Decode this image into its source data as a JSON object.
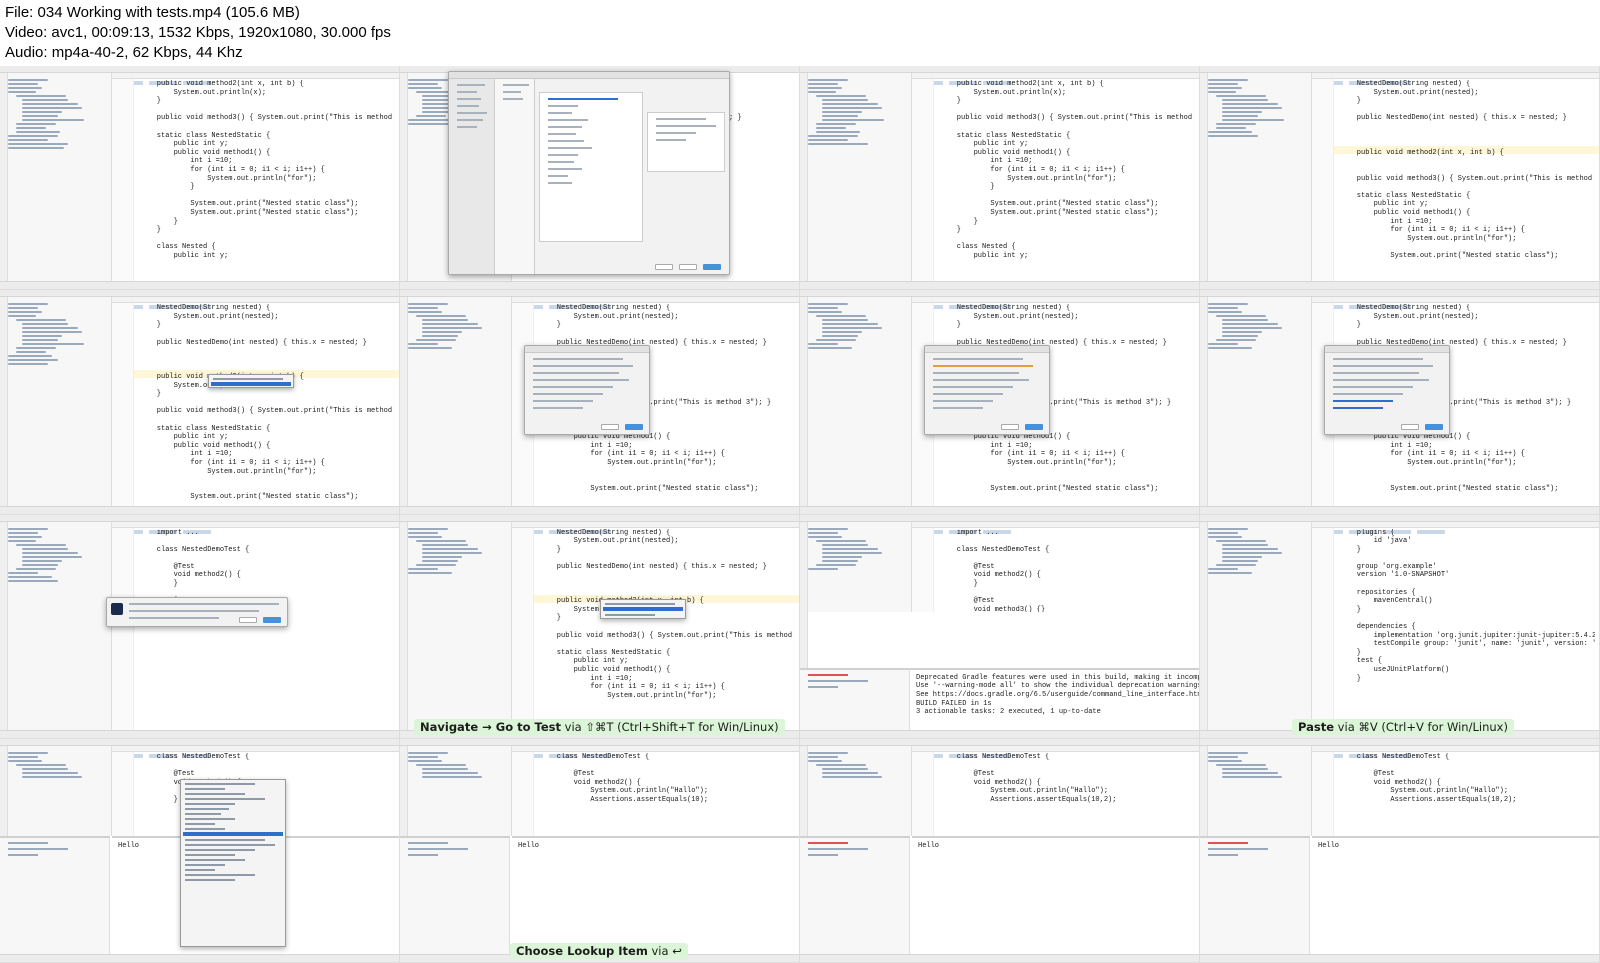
{
  "header": {
    "file_line": "File: 034 Working with tests.mp4 (105.6 MB)",
    "video_line": "Video: avc1, 00:09:13, 1532 Kbps, 1920x1080, 30.000 fps",
    "audio_line": "Audio: mp4a-40-2, 62 Kbps, 44 Khz"
  },
  "frames": [
    {
      "code": "    public void method2(int x, int b) {\n        System.out.println(x);\n    }\n\n    public void method3() { System.out.print(\"This is method 3\"); }\n\n    static class NestedStatic {\n        public int y;\n        public void method1() {\n            int i =10;\n            for (int i1 = 0; i1 < i; i1++) {\n                System.out.println(\"for\");\n            }\n\n            System.out.print(\"Nested static class\");\n            System.out.print(\"Nested static class\");\n        }\n    }\n\n    class Nested {\n        public int y;"
    },
    {
      "code": "\n\n\n\n                                   method 3\"); }"
    },
    {
      "code": "    public void method2(int x, int b) {\n        System.out.println(x);\n    }\n\n    public void method3() { System.out.print(\"This is method 3\"); }\n\n    static class NestedStatic {\n        public int y;\n        public void method1() {\n            int i =10;\n            for (int i1 = 0; i1 < i; i1++) {\n                System.out.println(\"for\");\n            }\n\n            System.out.print(\"Nested static class\");\n            System.out.print(\"Nested static class\");\n        }\n    }\n\n    class Nested {\n        public int y;"
    },
    {
      "code": "    NestedDemo(String nested) {\n        System.out.print(nested);\n    }\n\n    public NestedDemo(int nested) { this.x = nested; }\n\n\n\n    public void method2(int x, int b) {\n\n\n    public void method3() { System.out.print(\"This is method 3\"); }\n\n    static class NestedStatic {\n        public int y;\n        public void method1() {\n            int i =10;\n            for (int i1 = 0; i1 < i; i1++) {\n                System.out.println(\"for\");\n\n            System.out.print(\"Nested static class\");"
    },
    {
      "code": "    NestedDemo(String nested) {\n        System.out.print(nested);\n    }\n\n    public NestedDemo(int nested) { this.x = nested; }\n\n\n\n    public void method2(int x, int b) {\n        System.out.pri\n    }\n\n    public void method3() { System.out.print(\"This is method 3\"); }\n\n    static class NestedStatic {\n        public int y;\n        public void method1() {\n            int i =10;\n            for (int i1 = 0; i1 < i; i1++) {\n                System.out.println(\"for\");\n\n\n            System.out.print(\"Nested static class\");"
    },
    {
      "code": "    NestedDemo(String nested) {\n        System.out.print(nested);\n    }\n\n    public NestedDemo(int nested) { this.x = nested; }\n\n\n\n\n\n\n                      .out.print(\"This is method 3\"); }\n\n\n\n        public void method1() {\n            int i =10;\n            for (int i1 = 0; i1 < i; i1++) {\n                System.out.println(\"for\");\n\n\n            System.out.print(\"Nested static class\");"
    },
    {
      "code": "    NestedDemo(String nested) {\n        System.out.print(nested);\n    }\n\n    public NestedDemo(int nested) { this.x = nested; }\n\n\n\n\n\n\n                      .out.print(\"This is method 3\"); }\n\n\n\n        public void method1() {\n            int i =10;\n            for (int i1 = 0; i1 < i; i1++) {\n                System.out.println(\"for\");\n\n\n            System.out.print(\"Nested static class\");"
    },
    {
      "code": "    NestedDemo(String nested) {\n        System.out.print(nested);\n    }\n\n    public NestedDemo(int nested) { this.x = nested; }\n\n\n\n\n\n\n                      .out.print(\"This is method 3\"); }\n\n\n\n        public void method1() {\n            int i =10;\n            for (int i1 = 0; i1 < i; i1++) {\n                System.out.println(\"for\");\n\n\n            System.out.print(\"Nested static class\");"
    },
    {
      "code": "    import ...\n\n    class NestedDemoTest {\n\n        @Test\n        void method2() {\n        }\n\n        @Test\n        void method3() {"
    },
    {
      "code": "    NestedDemo(String nested) {\n        System.out.print(nested);\n    }\n\n    public NestedDemo(int nested) { this.x = nested; }\n\n\n\n    public void method2(int x, int b) {\n        System.out.pr\n    }\n\n    public void method3() { System.out.print(\"This is method 3\"); }\n\n    static class NestedStatic {\n        public int y;\n        public void method1() {\n            int i =10;\n            for (int i1 = 0; i1 < i; i1++) {\n                System.out.println(\"for\");"
    },
    {
      "code": "    import ...\n\n    class NestedDemoTest {\n\n        @Test\n        void method2() {\n        }\n\n        @Test\n        void method3() {}",
      "console": "Deprecated Gradle features were used in this build, making it incompatib\nUse '--warning-mode all' to show the individual deprecation warnings.\nSee https://docs.gradle.org/6.5/userguide/command_line_interface.html#sec\nBUILD FAILED in 1s\n3 actionable tasks: 2 executed, 1 up-to-date"
    },
    {
      "code": "    plugins {\n        id 'java'\n    }\n\n    group 'org.example'\n    version '1.0-SNAPSHOT'\n\n    repositories {\n        mavenCentral()\n    }\n\n    dependencies {\n        implementation 'org.junit.jupiter:junit-jupiter:5.4.2'\n        testCompile group: 'junit', name: 'junit', version: '4.12'\n    }\n    test {\n        useJUnitPlatform()\n    }"
    },
    {
      "code": "    class NestedDemoTest {\n\n        @Test\n        void method2() {\n\n        }",
      "console": "Hello"
    },
    {
      "code": "    class NestedDemoTest {\n\n        @Test\n        void method2() {\n            System.out.println(\"Hallo\");\n            Assertions.assertEquals(10);",
      "console": "Hello"
    },
    {
      "code": "    class NestedDemoTest {\n\n        @Test\n        void method2() {\n            System.out.println(\"Hallo\");\n            Assertions.assertEquals(10,2);",
      "console": "Hello"
    },
    {
      "code": "    class NestedDemoTest {\n\n        @Test\n        void method2() {\n            System.out.println(\"Hallo\");\n            Assertions.assertEquals(10,2);",
      "console": "Hello"
    }
  ],
  "captions": {
    "navigate_prefix": "Navigate → ",
    "navigate_bold": "Go to Test",
    "navigate_suffix": " via ⇧⌘T (Ctrl+Shift+T for Win/Linux)",
    "paste_bold": "Paste",
    "paste_suffix": " via ⌘V (Ctrl+V for Win/Linux)",
    "lookup_bold": "Choose Lookup Item",
    "lookup_suffix": " via ↩"
  }
}
